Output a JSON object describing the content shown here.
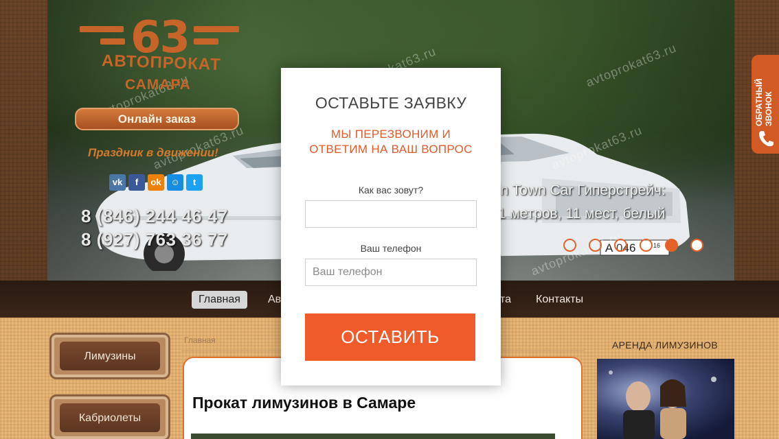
{
  "logo": {
    "number": "63",
    "line1": "АВТОПРОКАТ",
    "line2": "САМАРА",
    "icon": "logo-emblem"
  },
  "header": {
    "order_button": "Онлайн заказ",
    "slogan": "Праздник в движении!",
    "phones": [
      "8 (846) 244 46 47",
      "8 (927) 763 36 77"
    ],
    "socials": [
      {
        "name": "vk-icon",
        "glyph": "vk",
        "color": "#4a76a8"
      },
      {
        "name": "facebook-icon",
        "glyph": "f",
        "color": "#3b5998"
      },
      {
        "name": "odnoklassniki-icon",
        "glyph": "ok",
        "color": "#ee8208"
      },
      {
        "name": "moimir-icon",
        "glyph": "☺",
        "color": "#168de2"
      },
      {
        "name": "twitter-icon",
        "glyph": "t",
        "color": "#1da1f2"
      }
    ]
  },
  "slider": {
    "caption_line1": "ncoln Town Car Гиперстрейч:",
    "caption_line2": "а- 11 метров, 11 мест, белый",
    "plate": "А 046",
    "plate_region": "16",
    "dots_count": 6,
    "active_dot": 5,
    "watermark": "avtoprokat63.ru"
  },
  "callback_tab": {
    "line1": "ОБРАТНЫЙ",
    "line2": "ЗВОНОК",
    "icon": "phone-icon"
  },
  "nav": {
    "items": [
      {
        "label": "Главная",
        "active": true
      },
      {
        "label": "Ав",
        "active": false
      },
      {
        "label": "та",
        "active": false
      },
      {
        "label": "Контакты",
        "active": false
      }
    ]
  },
  "sidebar": {
    "items": [
      {
        "label": "Лимузины"
      },
      {
        "label": "Кабриолеты"
      }
    ]
  },
  "main": {
    "breadcrumb": "Главная",
    "title": "Прокат лимузинов в Самаре"
  },
  "right_column": {
    "heading": "АРЕНДА ЛИМУЗИНОВ"
  },
  "modal": {
    "title": "ОСТАВЬТЕ ЗАЯВКУ",
    "subtitle_line1": "МЫ ПЕРЕЗВОНИМ И",
    "subtitle_line2": "ОТВЕТИМ НА ВАШ ВОПРОС",
    "name_label": "Как вас зовут?",
    "name_value": "",
    "name_placeholder": "",
    "phone_label": "Ваш телефон",
    "phone_value": "",
    "phone_placeholder": "Ваш телефон",
    "submit_label": "ОСТАВИТЬ"
  },
  "colors": {
    "accent": "#ef5b2a",
    "brand_orange": "#c6642a",
    "nav_bg": "#2a1b12",
    "content_bg": "#e8b574"
  }
}
